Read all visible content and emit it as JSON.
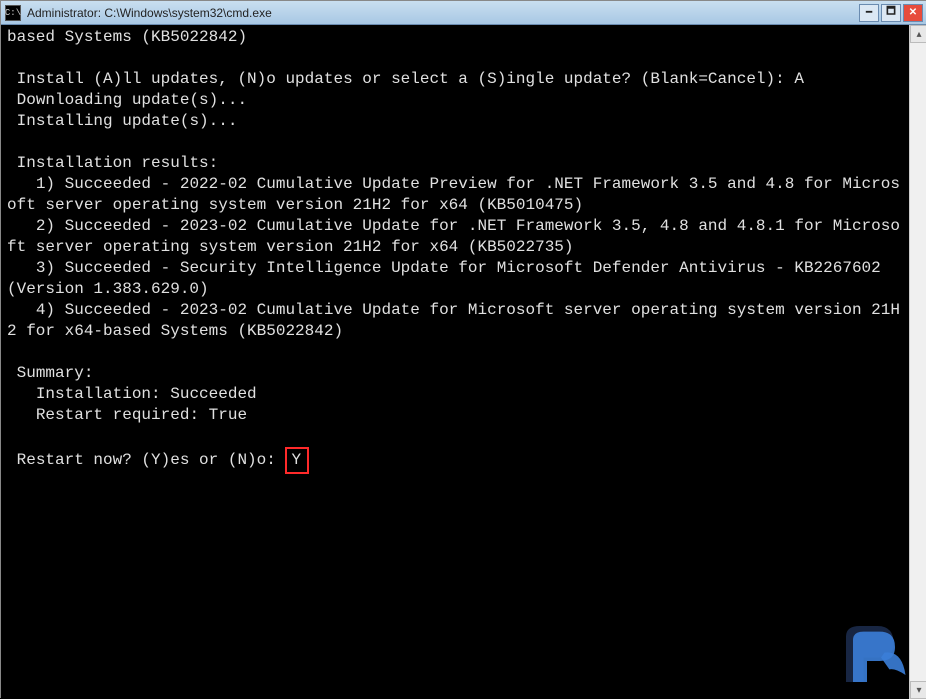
{
  "titlebar": {
    "icon_glyph": "C:\\",
    "title": "Administrator: C:\\Windows\\system32\\cmd.exe",
    "minimize_glyph": "🗕",
    "maximize_glyph": "🗖",
    "close_glyph": "✕"
  },
  "console": {
    "lines": [
      "based Systems (KB5022842)",
      "",
      " Install (A)ll updates, (N)o updates or select a (S)ingle update? (Blank=Cancel): A",
      " Downloading update(s)...",
      " Installing update(s)...",
      "",
      " Installation results:",
      "   1) Succeeded - 2022-02 Cumulative Update Preview for .NET Framework 3.5 and 4.8 for Microsoft server operating system version 21H2 for x64 (KB5010475)",
      "   2) Succeeded - 2023-02 Cumulative Update for .NET Framework 3.5, 4.8 and 4.8.1 for Microsoft server operating system version 21H2 for x64 (KB5022735)",
      "   3) Succeeded - Security Intelligence Update for Microsoft Defender Antivirus - KB2267602 (Version 1.383.629.0)",
      "   4) Succeeded - 2023-02 Cumulative Update for Microsoft server operating system version 21H2 for x64-based Systems (KB5022842)",
      "",
      " Summary:",
      "   Installation: Succeeded",
      "   Restart required: True",
      ""
    ],
    "restart_prompt": " Restart now? (Y)es or (N)o: ",
    "restart_answer": "Y"
  },
  "scrollbar": {
    "up_glyph": "▴",
    "down_glyph": "▾"
  },
  "logo": {
    "name": "watermark-logo"
  }
}
